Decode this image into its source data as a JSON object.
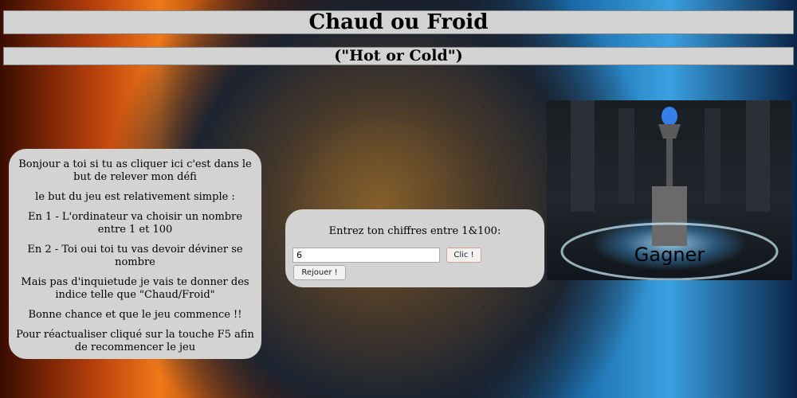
{
  "header": {
    "title": "Chaud ou Froid",
    "subtitle": "(\"Hot or Cold\")"
  },
  "rules": {
    "paragraphs": [
      "Bonjour a toi si tu as cliquer ici c'est dans le but de relever mon défi",
      "le but du jeu est relativement simple :",
      "En 1 - L'ordinateur va choisir un nombre entre 1 et 100",
      "En 2 - Toi oui toi tu vas devoir déviner se nombre",
      "Mais pas d'inquietude je vais te donner des indice telle que \"Chaud/Froid\"",
      "Bonne chance et que le jeu commence !!",
      "Pour réactualiser cliqué sur la touche F5 afin de recommencer le jeu"
    ]
  },
  "game": {
    "prompt": "Entrez ton chiffres entre 1&100:",
    "input_value": "6",
    "submit_label": "Clic !",
    "replay_label": "Rejouer !"
  },
  "win_image": {
    "label": "Gagner"
  }
}
